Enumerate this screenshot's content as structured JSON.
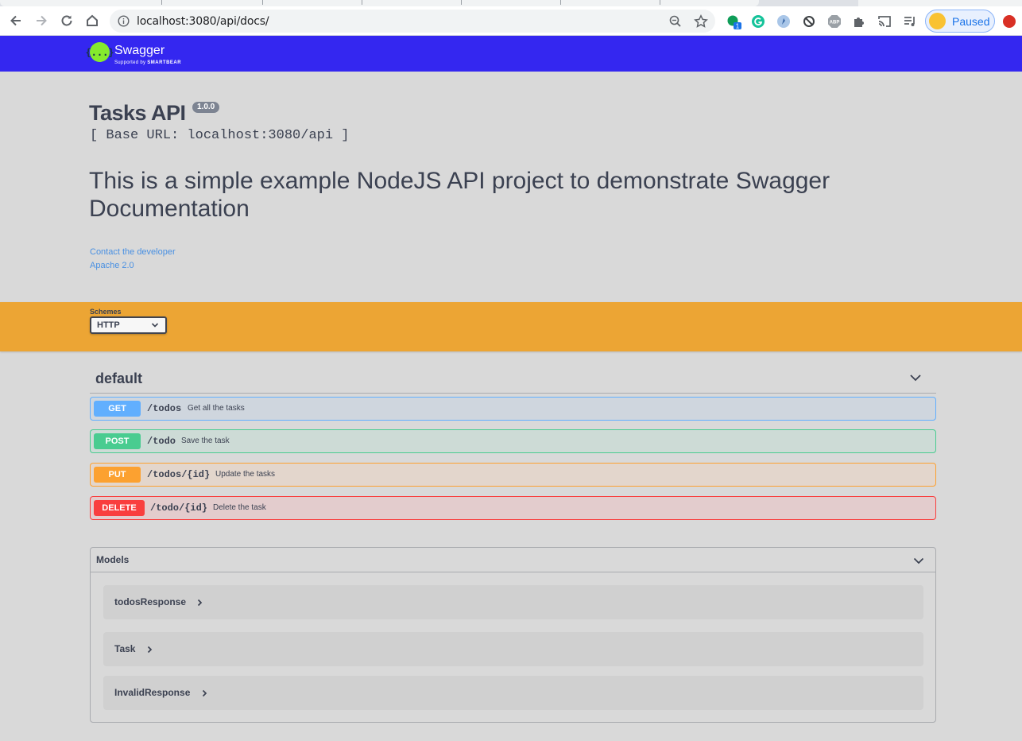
{
  "browser": {
    "url": "localhost:3080/api/docs/",
    "profile_label": "Paused",
    "extension_badge": "1"
  },
  "swagger": {
    "brand": "Swagger",
    "supported_by": "Supported by",
    "smartbear": "SMARTBEAR",
    "logo_glyph": "{...}"
  },
  "info": {
    "title": "Tasks API",
    "version": "1.0.0",
    "base_url": "[ Base URL: localhost:3080/api ]",
    "description": "This is a simple example NodeJS API project to demonstrate Swagger Documentation",
    "contact_link": "Contact the developer",
    "license_link": "Apache 2.0"
  },
  "schemes": {
    "label": "Schemes",
    "selected": "HTTP"
  },
  "tag": {
    "name": "default",
    "operations": [
      {
        "method": "GET",
        "path": "/todos",
        "summary": "Get all the tasks"
      },
      {
        "method": "POST",
        "path": "/todo",
        "summary": "Save the task"
      },
      {
        "method": "PUT",
        "path": "/todos/{id}",
        "summary": "Update the tasks"
      },
      {
        "method": "DELETE",
        "path": "/todo/{id}",
        "summary": "Delete the task"
      }
    ]
  },
  "models": {
    "title": "Models",
    "items": [
      {
        "name": "todosResponse"
      },
      {
        "name": "Task"
      },
      {
        "name": "InvalidResponse"
      }
    ]
  },
  "colors": {
    "topbar": "#3427f0",
    "schemes_bar": "#eca534",
    "get": "#61affe",
    "post": "#49cc90",
    "put": "#fca130",
    "delete": "#f93e3e"
  }
}
